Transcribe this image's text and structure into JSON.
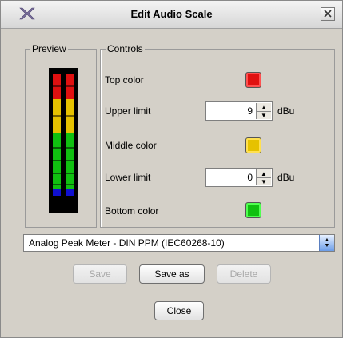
{
  "window": {
    "title": "Edit Audio Scale",
    "icon": "x-logo-icon",
    "close_icon": "close-icon"
  },
  "preview": {
    "legend": "Preview",
    "meter": {
      "segments": [
        "red",
        "yellow",
        "green",
        "blue"
      ]
    }
  },
  "controls": {
    "legend": "Controls",
    "top_color_label": "Top color",
    "upper_limit_label": "Upper limit",
    "upper_limit_value": "9",
    "upper_limit_unit": "dBu",
    "middle_color_label": "Middle color",
    "lower_limit_label": "Lower limit",
    "lower_limit_value": "0",
    "lower_limit_unit": "dBu",
    "bottom_color_label": "Bottom color"
  },
  "colors": {
    "top": "#e01010",
    "middle": "#e6c200",
    "bottom": "#10c010",
    "meter_blue": "#1010d0"
  },
  "scale_select": {
    "selected": "Analog Peak Meter - DIN PPM (IEC60268-10)"
  },
  "buttons": {
    "save": "Save",
    "save_as": "Save as",
    "delete": "Delete",
    "close": "Close"
  }
}
